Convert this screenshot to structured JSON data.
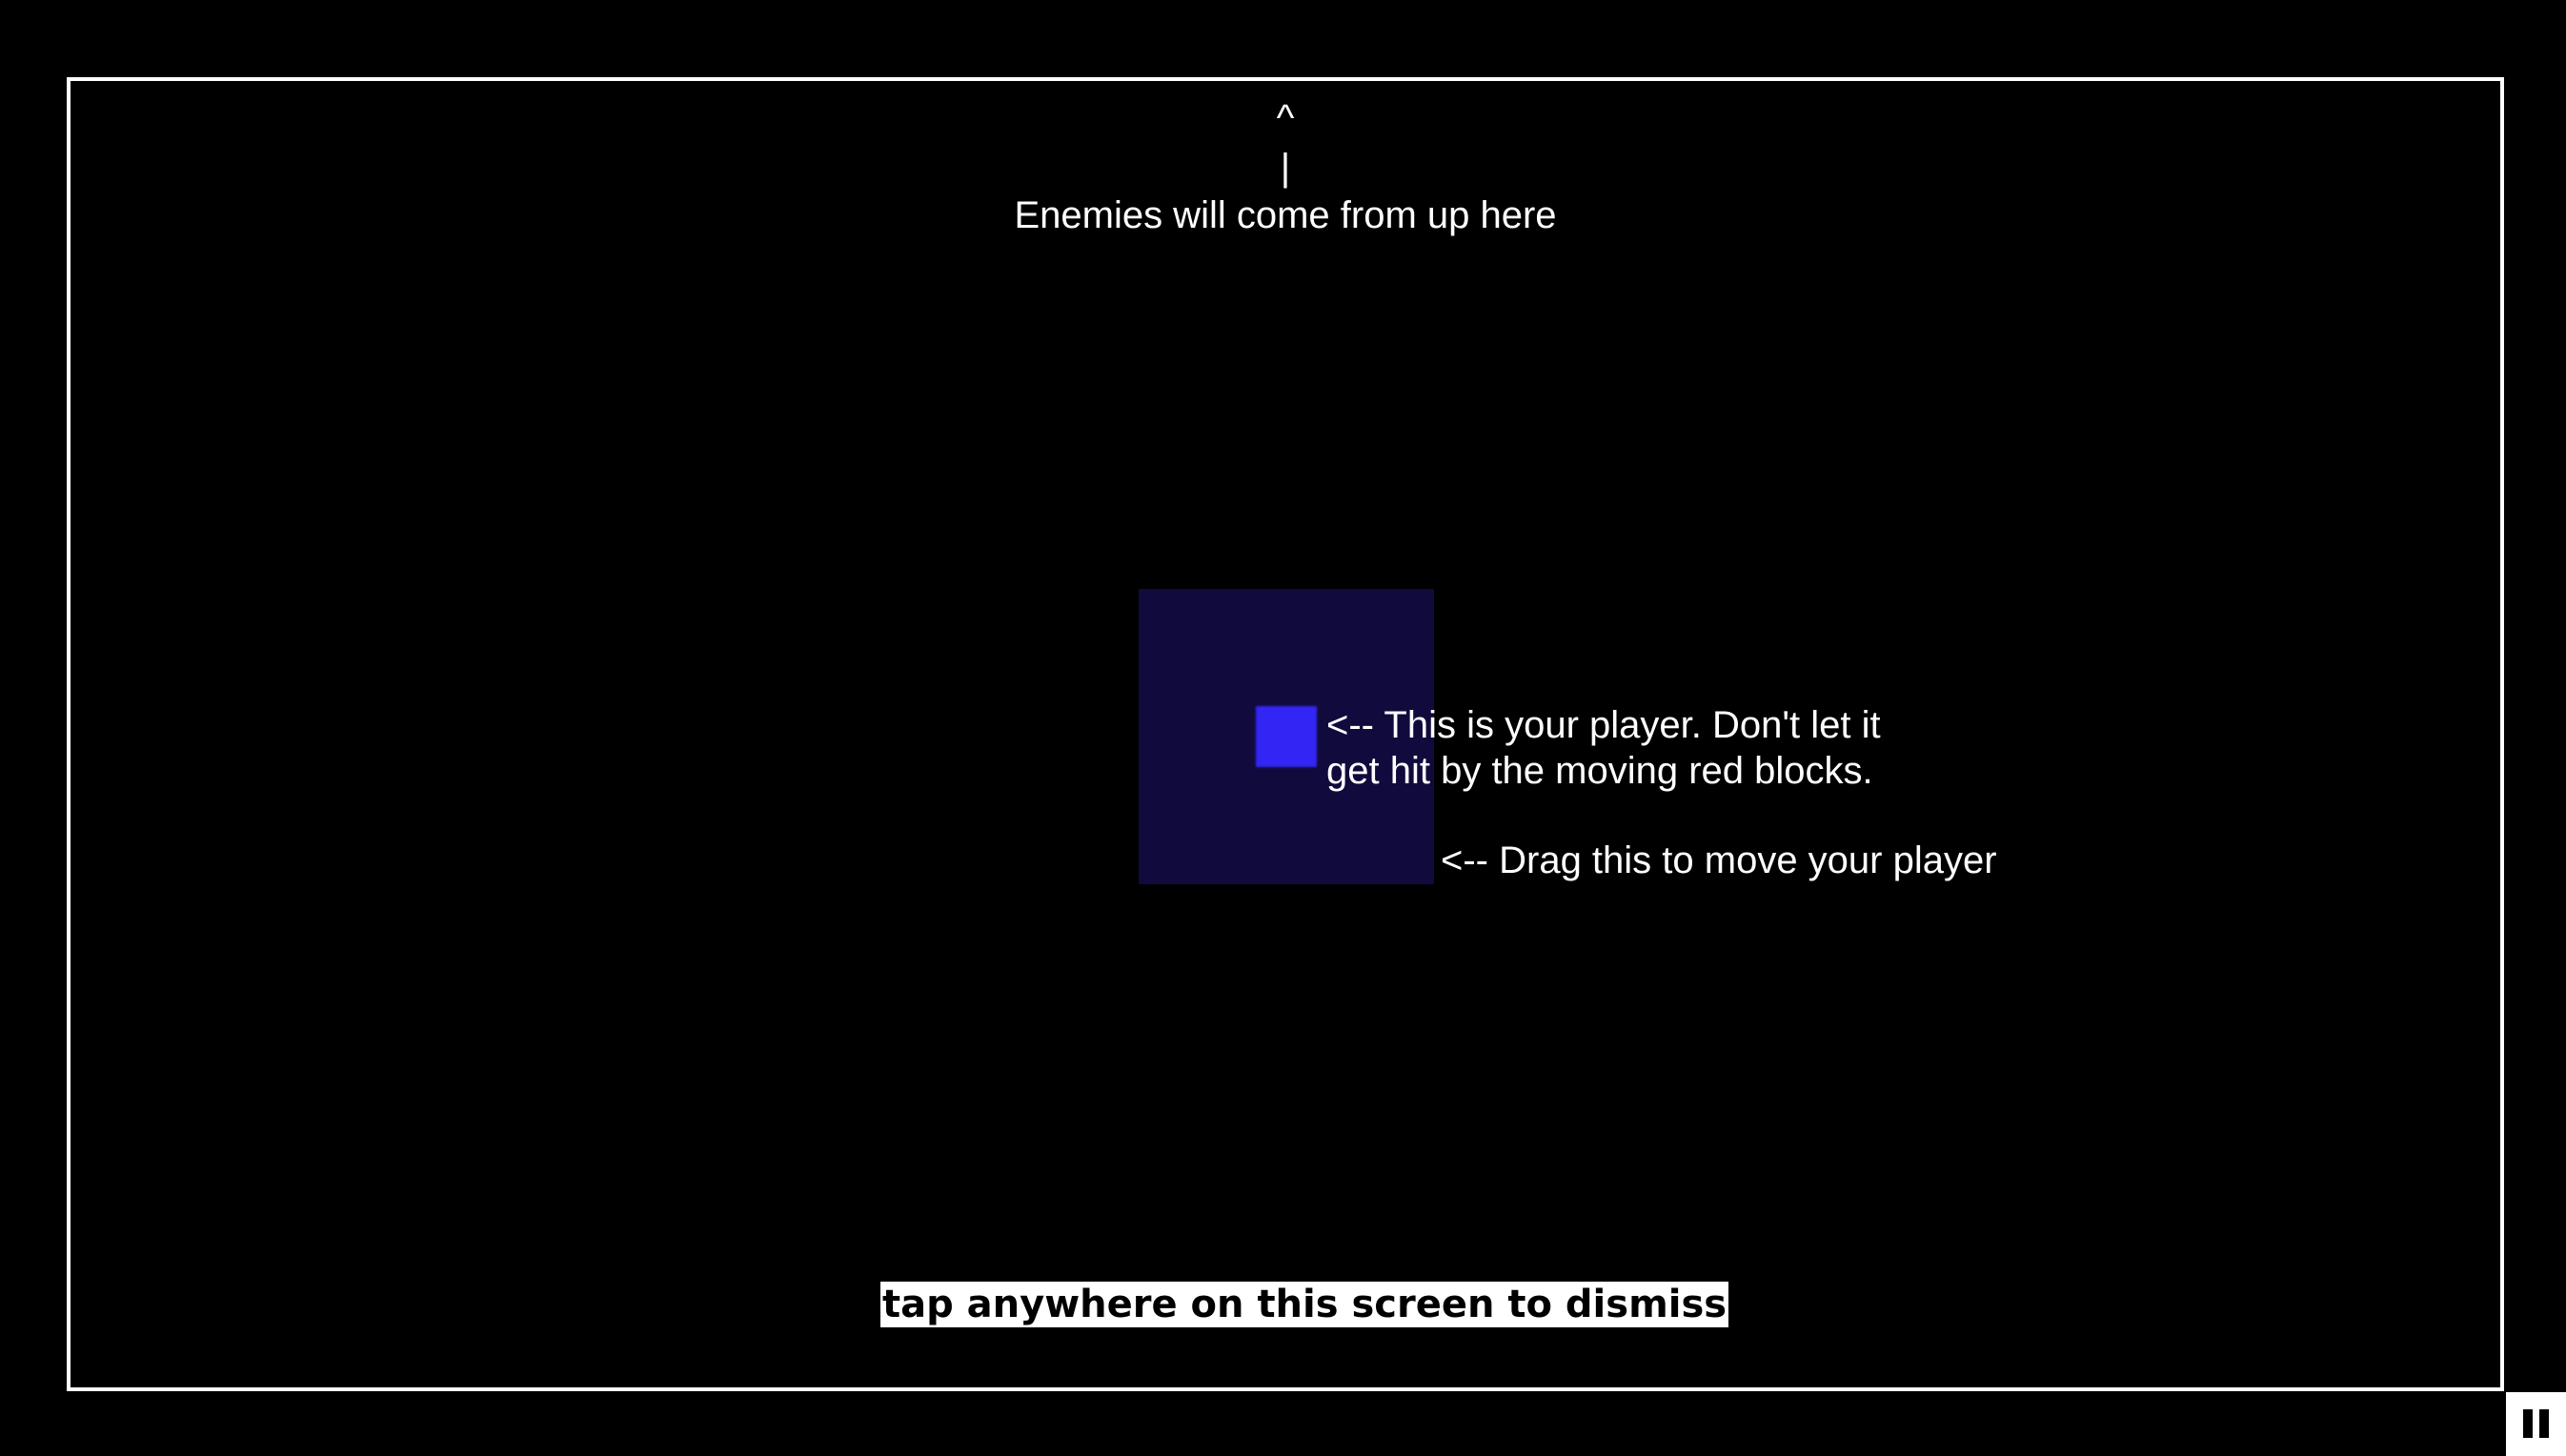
{
  "hints": {
    "top_caret": "^",
    "top_bar": "|",
    "top_text": "Enemies will come from up here",
    "player_text": "<-- This is your player. Don't let it get hit by the moving red blocks.",
    "drag_text": "<-- Drag this to move your player",
    "dismiss_text": "tap anywhere on this screen to dismiss"
  },
  "icons": {
    "pause": "pause-icon"
  },
  "colors": {
    "background": "#000000",
    "arena_border": "#ffffff",
    "player": "#3326f5",
    "drag_area": "#110a3c",
    "text": "#ffffff"
  }
}
